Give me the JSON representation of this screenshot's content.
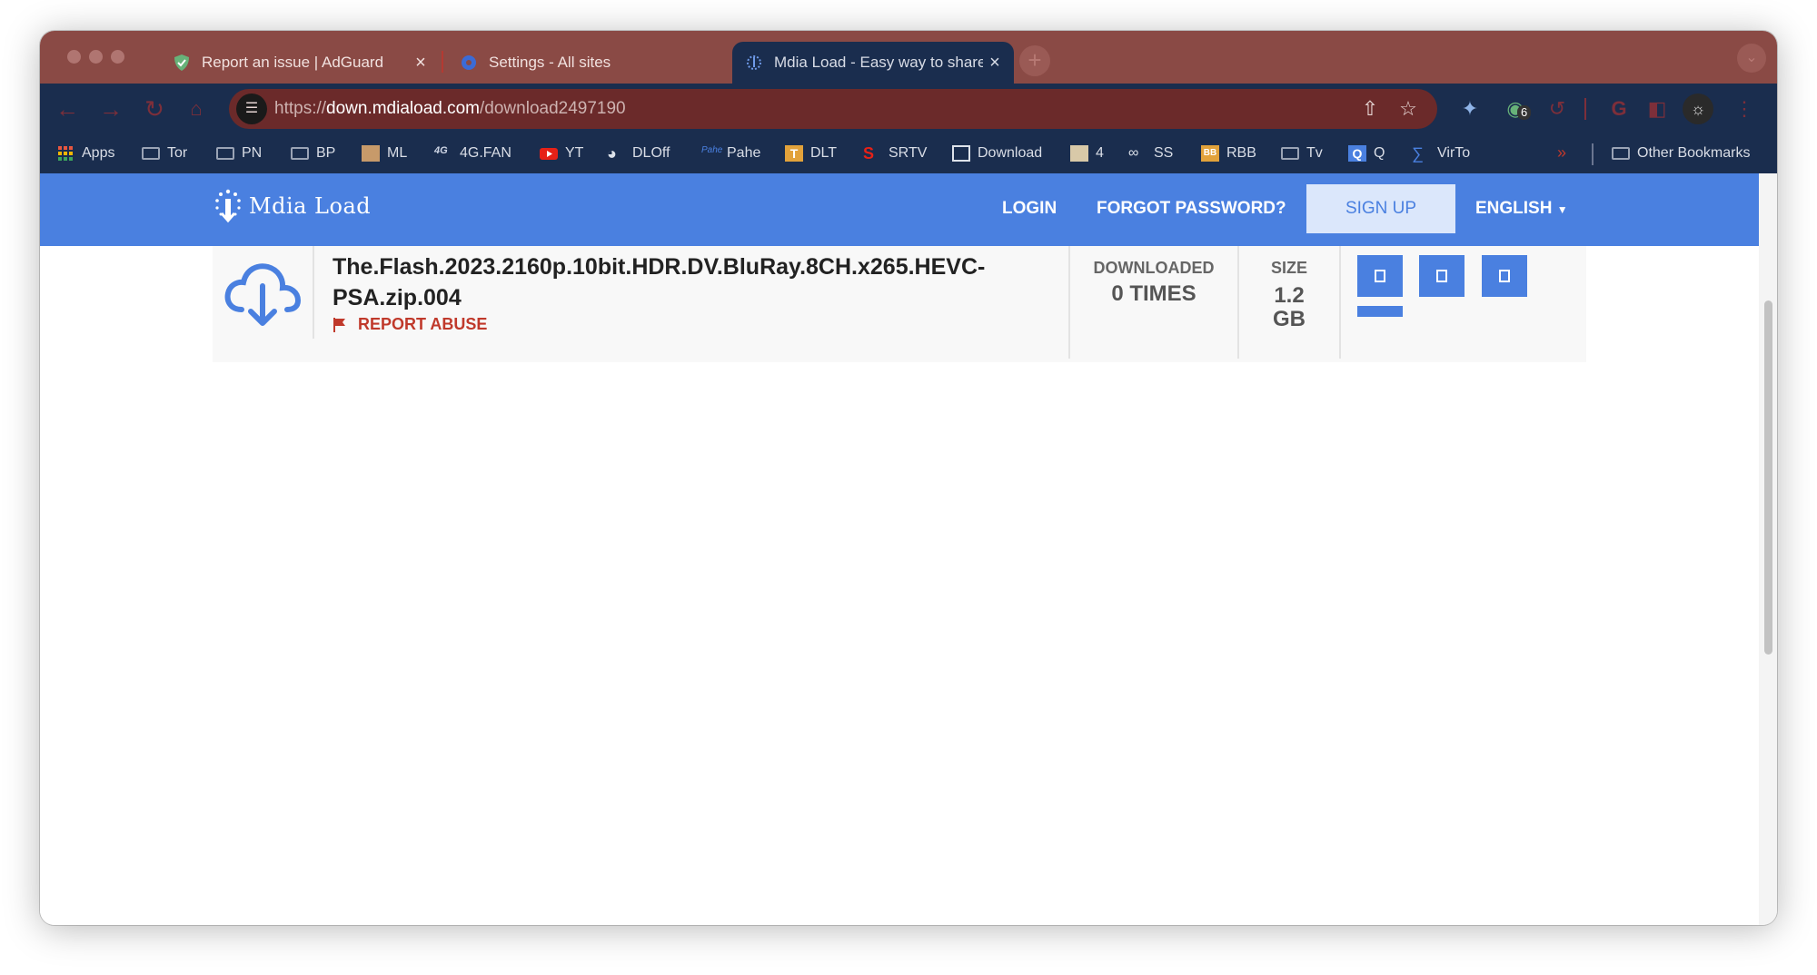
{
  "browser": {
    "tabs": [
      {
        "title": "Report an issue | AdGuard",
        "close": "×"
      },
      {
        "title": "Settings - All sites",
        "close": "×"
      },
      {
        "title": "Mdia Load - Easy way to share",
        "close": "×"
      }
    ],
    "new_tab": "+",
    "address": {
      "scheme": "https://",
      "host": "down.mdiaload.com",
      "path": "/download2497190"
    },
    "extension_badge": "6",
    "bookmarks": [
      {
        "label": "Apps",
        "icon": "apps-grid-icon"
      },
      {
        "label": "Tor",
        "icon": "folder-icon"
      },
      {
        "label": "PN",
        "icon": "folder-icon"
      },
      {
        "label": "BP",
        "icon": "folder-icon"
      },
      {
        "label": "ML",
        "icon": "site-favicon"
      },
      {
        "label": "4G.FAN",
        "icon": "site-favicon"
      },
      {
        "label": "YT",
        "icon": "youtube-icon"
      },
      {
        "label": "DLOff",
        "icon": "globe-icon"
      },
      {
        "label": "Pahe",
        "icon": "site-favicon"
      },
      {
        "label": "DLT",
        "icon": "site-favicon"
      },
      {
        "label": "SRTV",
        "icon": "site-favicon"
      },
      {
        "label": "Download",
        "icon": "site-favicon"
      },
      {
        "label": "4",
        "icon": "site-favicon"
      },
      {
        "label": "SS",
        "icon": "site-favicon"
      },
      {
        "label": "RBB",
        "icon": "site-favicon"
      },
      {
        "label": "Tv",
        "icon": "folder-icon"
      },
      {
        "label": "Q",
        "icon": "site-favicon"
      },
      {
        "label": "VirTo",
        "icon": "site-favicon"
      }
    ],
    "overflow_chevron": "»",
    "other_bookmarks": "Other Bookmarks"
  },
  "site": {
    "logo_text": "Mdia Load",
    "nav": {
      "login": "LOGIN",
      "forgot": "FORGOT PASSWORD?",
      "signup": "SIGN UP",
      "language": "ENGLISH"
    }
  },
  "file": {
    "name": "The.Flash.2023.2160p.10bit.HDR.DV.BluRay.8CH.x265.HEVC-PSA.zip.004",
    "report_abuse": "REPORT ABUSE",
    "downloaded_label": "DOWNLOADED",
    "downloaded_value": "0 TIMES",
    "size_label": "SIZE",
    "size_value": "1.2 GB"
  },
  "colors": {
    "tabstrip": "#8a4a45",
    "toolbar": "#1a2d4e",
    "site_nav": "#4a80e0",
    "report": "#c0392b"
  }
}
